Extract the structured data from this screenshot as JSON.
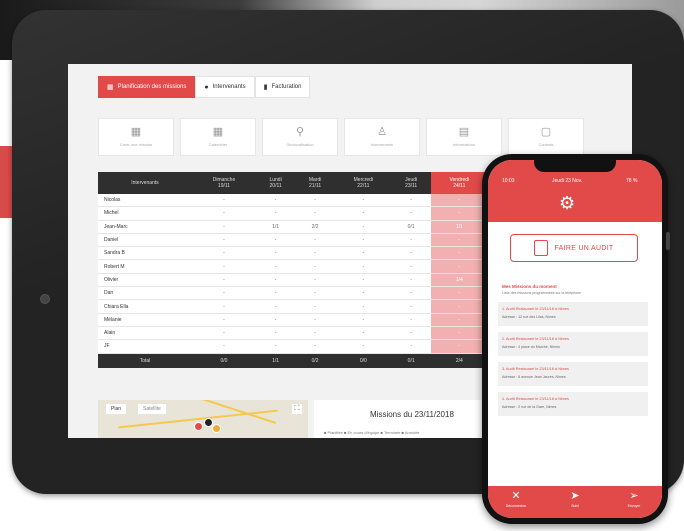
{
  "tabs": [
    {
      "label": "Planification des missions",
      "icon": "calendar-icon",
      "active": true
    },
    {
      "label": "Intervenants",
      "icon": "user-icon",
      "active": false
    },
    {
      "label": "Facturation",
      "icon": "document-icon",
      "active": false
    }
  ],
  "cards": [
    {
      "icon": "calendar-icon",
      "label": "Créer une mission"
    },
    {
      "icon": "calendar-icon",
      "label": "Calendrier"
    },
    {
      "icon": "location-pin-icon",
      "label": "Géolocalisation"
    },
    {
      "icon": "user-icon",
      "label": "Intervenants"
    },
    {
      "icon": "document-icon",
      "label": "Informations"
    },
    {
      "icon": "clipboard-icon",
      "label": "Contrats"
    }
  ],
  "schedule": {
    "columns": [
      {
        "day": "Intervenants",
        "date": "",
        "highlight": false
      },
      {
        "day": "Dimanche",
        "date": "19/11",
        "highlight": false
      },
      {
        "day": "Lundi",
        "date": "20/11",
        "highlight": false
      },
      {
        "day": "Mardi",
        "date": "21/11",
        "highlight": false
      },
      {
        "day": "Mercredi",
        "date": "22/11",
        "highlight": false
      },
      {
        "day": "Jeudi",
        "date": "23/11",
        "highlight": false
      },
      {
        "day": "Vendredi",
        "date": "24/11",
        "highlight": true
      }
    ],
    "rows": [
      {
        "name": "Nicolas",
        "cells": [
          "-",
          "-",
          "-",
          "-",
          "-",
          "-"
        ]
      },
      {
        "name": "Michel",
        "cells": [
          "-",
          "-",
          "-",
          "-",
          "-",
          "-"
        ]
      },
      {
        "name": "Jean-Marc",
        "cells": [
          "-",
          "1/1",
          "2/2",
          "-",
          "0/1",
          "1/1"
        ]
      },
      {
        "name": "Daniel",
        "cells": [
          "-",
          "-",
          "-",
          "-",
          "-",
          "-"
        ]
      },
      {
        "name": "Sandra B",
        "cells": [
          "-",
          "-",
          "-",
          "-",
          "-",
          "-"
        ]
      },
      {
        "name": "Robert M",
        "cells": [
          "-",
          "-",
          "-",
          "-",
          "-",
          "-"
        ]
      },
      {
        "name": "Olivier",
        "cells": [
          "-",
          "-",
          "-",
          "-",
          "-",
          "1/4"
        ]
      },
      {
        "name": "Dan",
        "cells": [
          "-",
          "-",
          "-",
          "-",
          "-",
          "-"
        ]
      },
      {
        "name": "Chiara Ella",
        "cells": [
          "-",
          "-",
          "-",
          "-",
          "-",
          "-"
        ]
      },
      {
        "name": "Mélanie",
        "cells": [
          "-",
          "-",
          "-",
          "-",
          "-",
          "-"
        ]
      },
      {
        "name": "Alain",
        "cells": [
          "-",
          "-",
          "-",
          "-",
          "-",
          "-"
        ]
      },
      {
        "name": "JF",
        "cells": [
          "-",
          "-",
          "-",
          "-",
          "-",
          "-"
        ]
      }
    ],
    "total": {
      "label": "Total",
      "cells": [
        "0/0",
        "1/1",
        "0/2",
        "0/0",
        "0/1",
        "2/4"
      ]
    }
  },
  "map": {
    "tab_map": "Plan",
    "tab_satellite": "Satellite",
    "zoom_icon": "fullscreen-icon"
  },
  "missions": {
    "title": "Missions du 23/11/2018",
    "legend": "■ Planifiée  ■ En cours d'équipe  ■ Terminée  ■ Annulée"
  },
  "phone": {
    "time": "10:03",
    "carrier": "Jeudi 23 Nov.",
    "battery": "78 %",
    "header_icon": "gear-icon",
    "audit_button": "FAIRE UN AUDIT",
    "list_title": "Mes Missions du moment",
    "list_subtitle": "Liste des missions programmées sur la téléphone",
    "missions": [
      {
        "title": "1. Audit Restaurant le 23/11/18 à Nimes",
        "detail": "Adresse : 12 rue des Lilas, Nimes"
      },
      {
        "title": "2. Audit Restaurant le 23/11/18 à Nimes",
        "detail": "Adresse : 4 place du Marché, Nimes"
      },
      {
        "title": "3. Audit Restaurant le 23/11/18 à Nimes",
        "detail": "Adresse : 8 avenue Jean Jaurès, Nimes"
      },
      {
        "title": "4. Audit Restaurant le 23/11/18 à Nimes",
        "detail": "Adresse : 2 rue de la Gare, Nimes"
      }
    ],
    "footer": [
      {
        "icon": "close-icon",
        "label": "Déconnexion"
      },
      {
        "icon": "location-icon",
        "label": "Suivi"
      },
      {
        "icon": "send-icon",
        "label": "Envoyer"
      }
    ]
  },
  "colors": {
    "accent": "#e24a4a",
    "dark": "#2f2f2f",
    "highlight": "#f2b0b0"
  }
}
